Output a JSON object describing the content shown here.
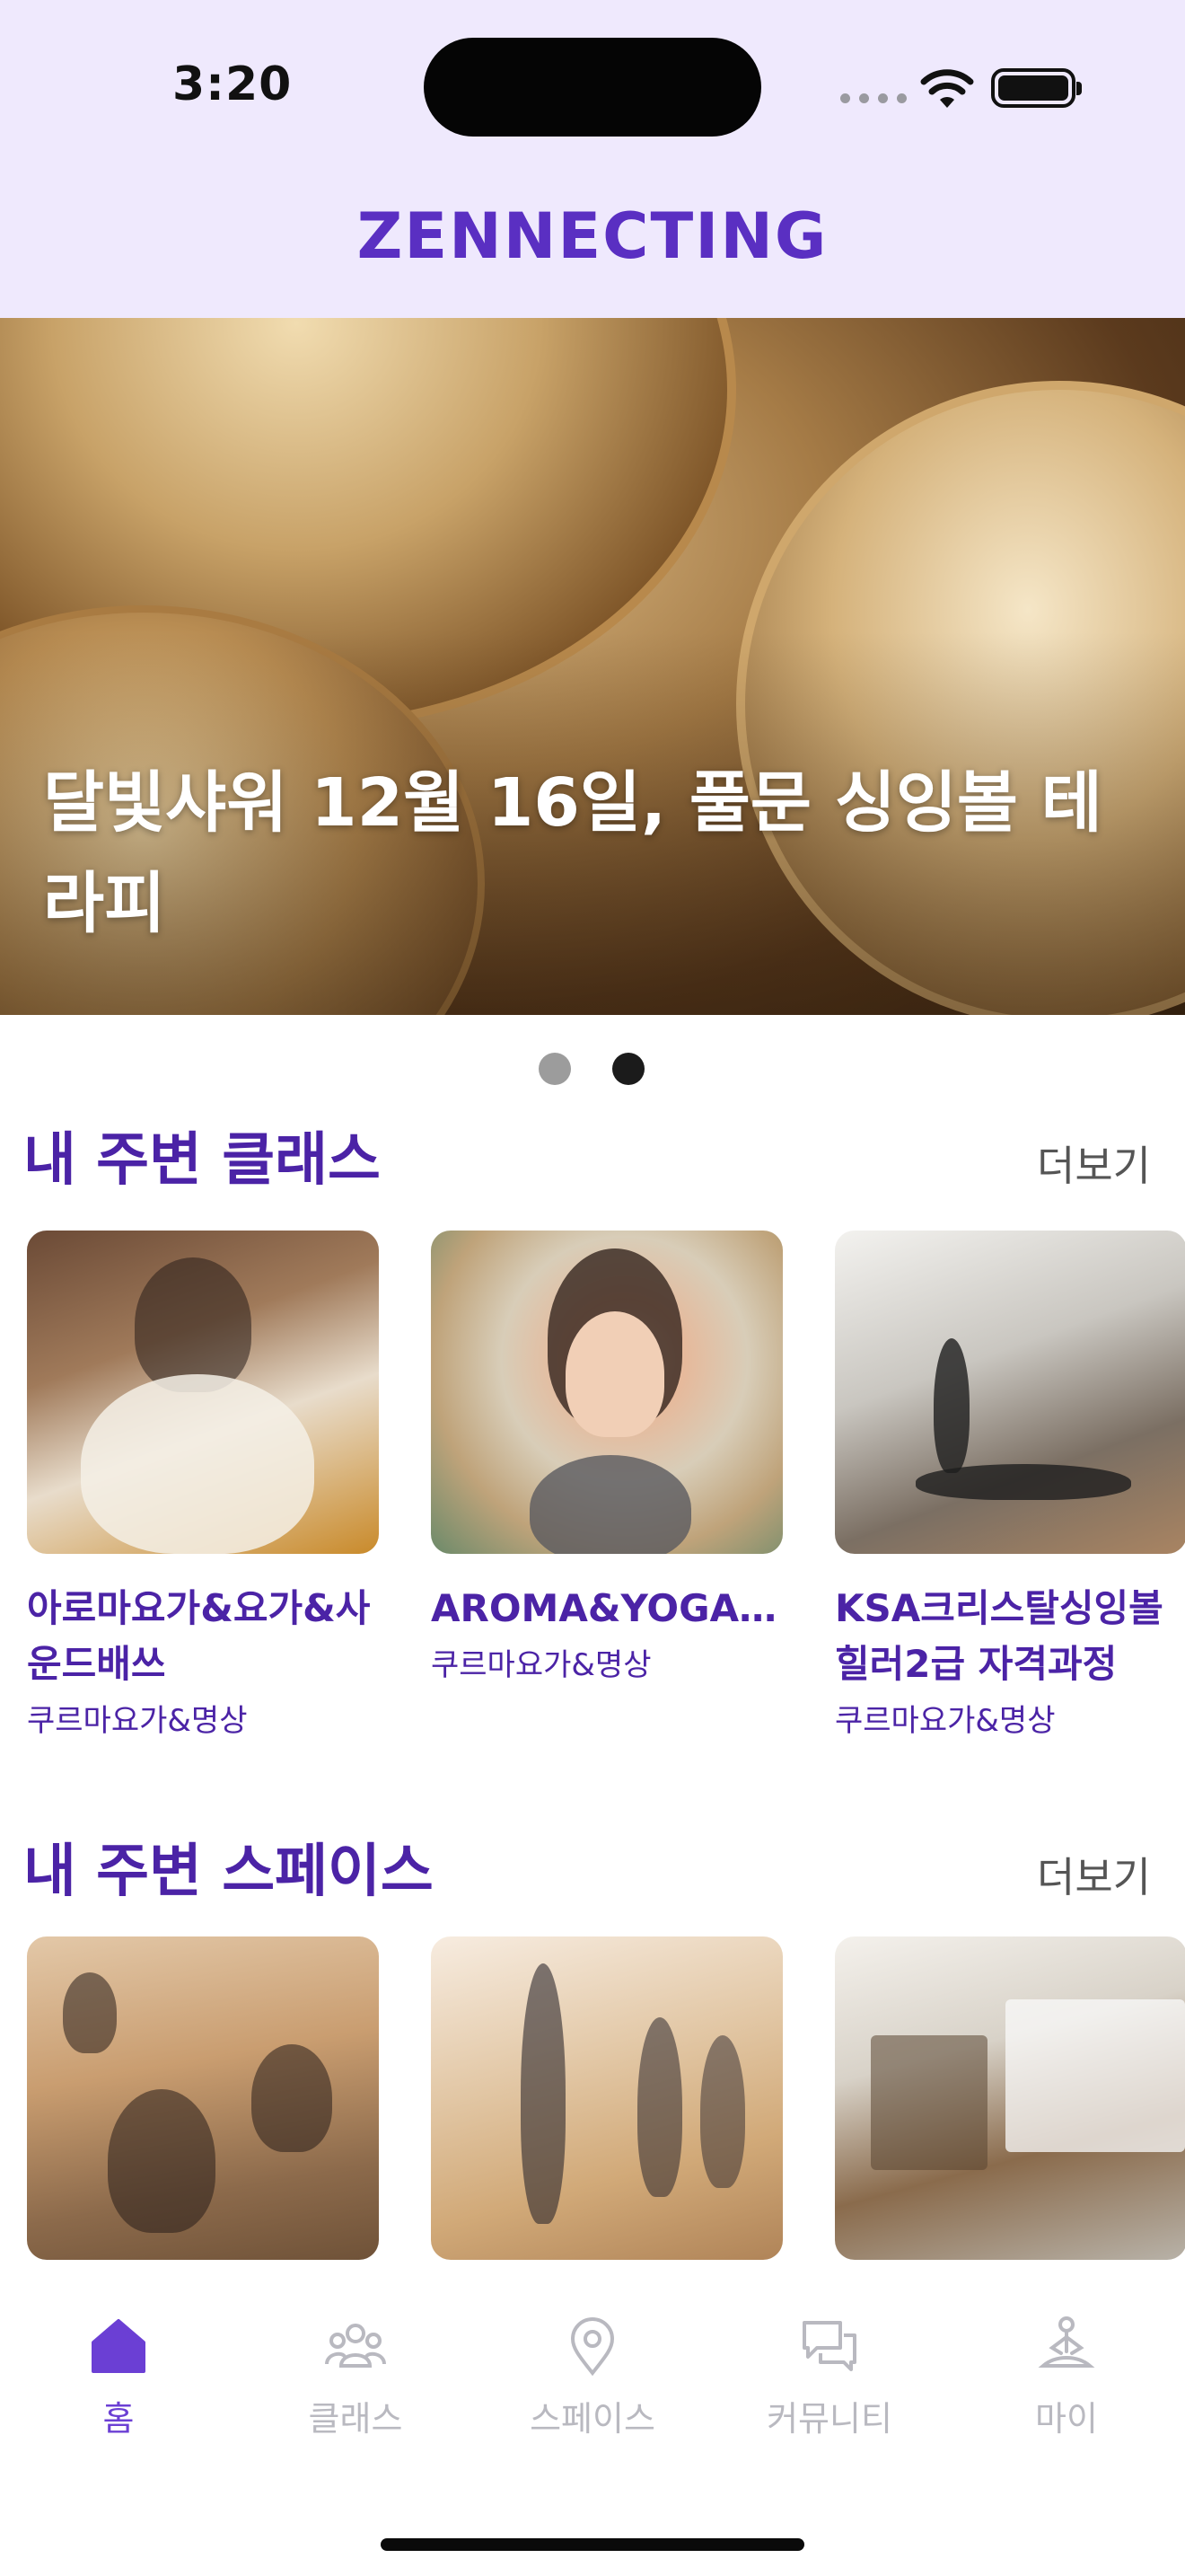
{
  "status_bar": {
    "time": "3:20"
  },
  "header": {
    "brand": "ZENNECTING"
  },
  "hero": {
    "title": "달빛샤워 12월 16일, 풀문 싱잉볼 테라피",
    "pages": 2,
    "active_page": 2
  },
  "classes": {
    "title": "내 주변 클래스",
    "more": "더보기",
    "items": [
      {
        "title": "아로마요가&요가&사운드배쓰",
        "subtitle": "쿠르마요가&명상"
      },
      {
        "title": "AROMA&YOGA&SOUNDBATH C...",
        "subtitle": "쿠르마요가&명상"
      },
      {
        "title": "KSA크리스탈싱잉볼힐러2급 자격과정",
        "subtitle": "쿠르마요가&명상"
      }
    ]
  },
  "spaces": {
    "title": "내 주변 스페이스",
    "more": "더보기"
  },
  "tabbar": {
    "items": [
      {
        "label": "홈",
        "icon": "home-icon"
      },
      {
        "label": "클래스",
        "icon": "people-icon"
      },
      {
        "label": "스페이스",
        "icon": "location-pin-icon"
      },
      {
        "label": "커뮤니티",
        "icon": "chat-bubbles-icon"
      },
      {
        "label": "마이",
        "icon": "meditation-person-icon"
      }
    ],
    "active_index": 0,
    "active_color": "#6b3fd4",
    "inactive_color": "#b9b9c0"
  },
  "colors": {
    "brand": "#5a2fc2",
    "header_bg": "#efe9fd",
    "section_title": "#4b23a6"
  }
}
